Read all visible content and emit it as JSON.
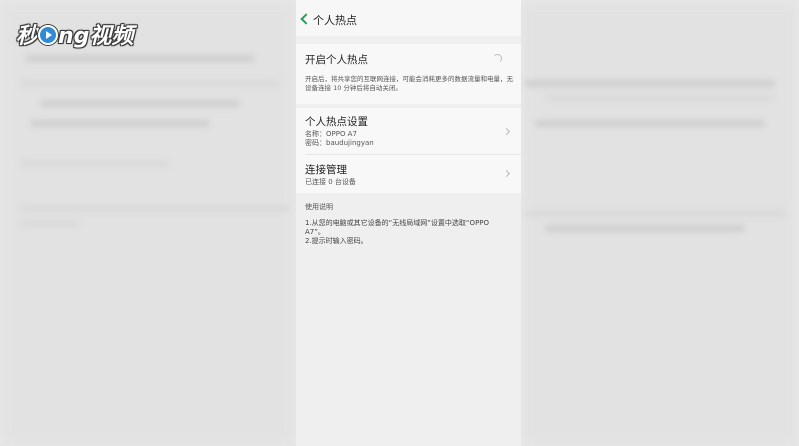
{
  "watermark": {
    "text_left": "秒",
    "text_right": "ng视频"
  },
  "header": {
    "title": "个人热点"
  },
  "hotspot_toggle": {
    "label": "开启个人热点",
    "description": "开启后，将共享您的互联网连接，可能会消耗更多的数据流量和电量，无设备连接 10 分钟后将自动关闭。"
  },
  "settings": {
    "label": "个人热点设置",
    "name_line": "名称：OPPO A7",
    "password_line": "密码：baudujingyan"
  },
  "connections": {
    "label": "连接管理",
    "status": "已连接 0 台设备"
  },
  "usage": {
    "title": "使用说明",
    "line1": "1.从您的电脑或其它设备的“无线局域网”设置中选取“OPPO A7”。",
    "line2": "2.提示时输入密码。"
  },
  "colors": {
    "accent": "#2a9d5a",
    "background": "#e9e9e9",
    "card": "#f8f8f8"
  },
  "icons": {
    "back": "chevron-left-icon",
    "spinner": "loading-spinner-icon",
    "row": "chevron-right-icon",
    "logo": "play-circle-icon"
  }
}
